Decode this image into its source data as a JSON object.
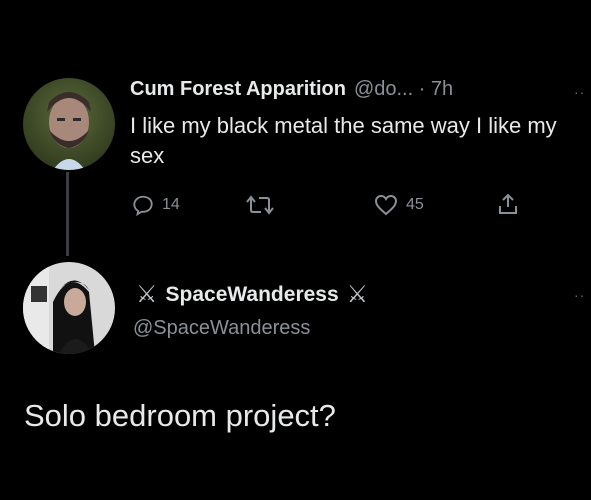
{
  "tweet": {
    "author_name": "Cum Forest Apparition",
    "handle_and_time": "@do... · 7h",
    "text": "I like my black metal the same way I like my sex",
    "reply_count": "14",
    "retweet_count": "",
    "like_count": "45",
    "more_icon": "··"
  },
  "reply": {
    "name_prefix_icon": "⚔",
    "author_name": "SpaceWanderess",
    "name_suffix_icon": "⚔",
    "handle": "@SpaceWanderess",
    "text": "Solo bedroom project?",
    "more_icon": "··"
  },
  "icons": {
    "reply": "reply-icon",
    "retweet": "retweet-icon",
    "like": "heart-icon",
    "share": "share-icon"
  }
}
